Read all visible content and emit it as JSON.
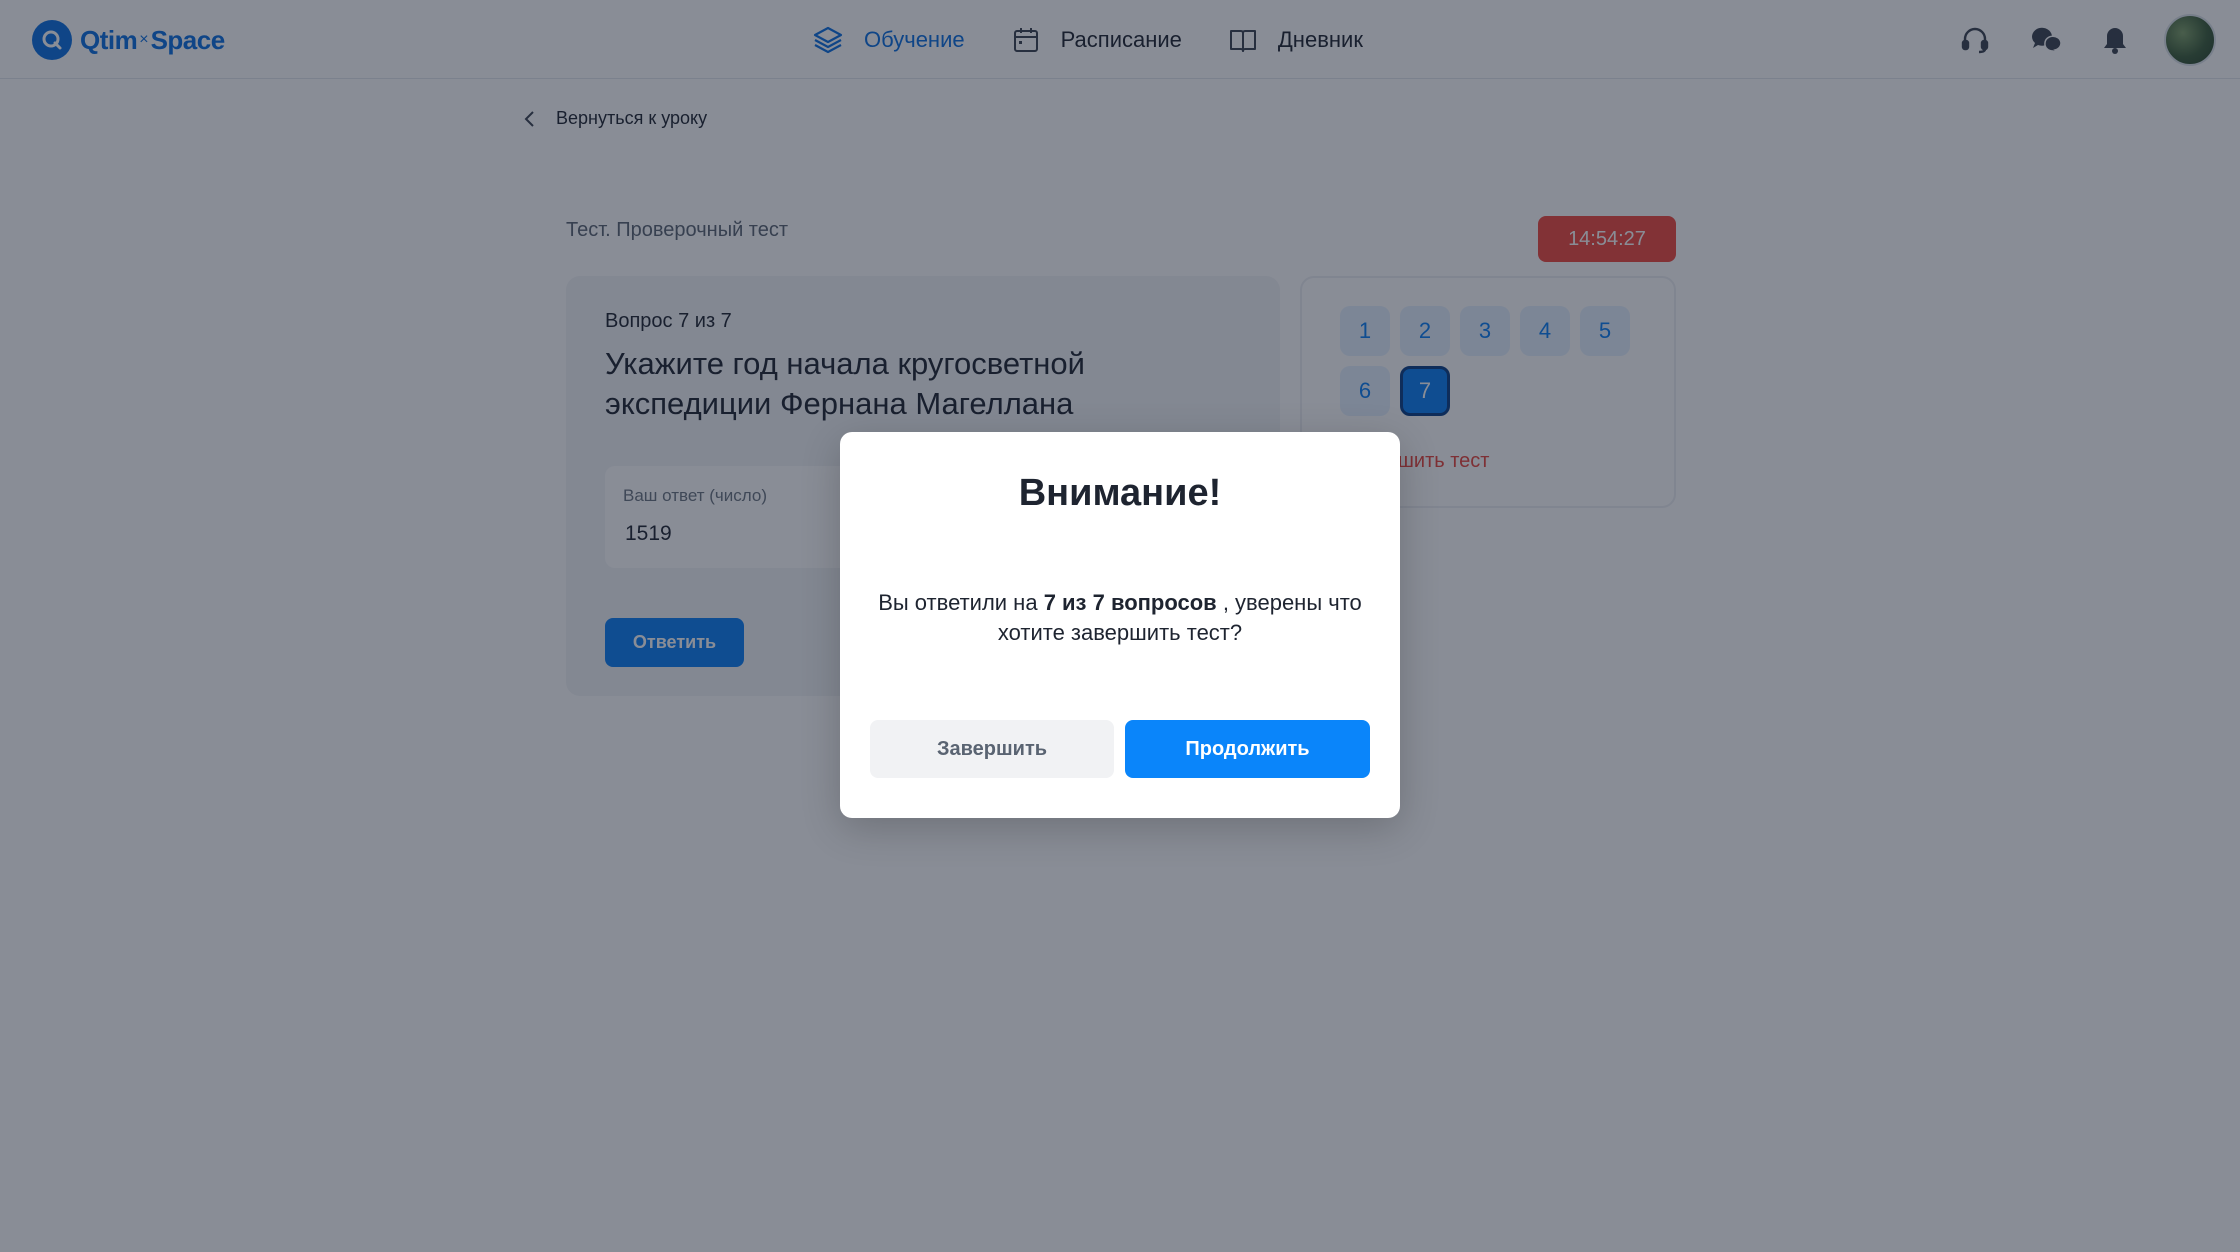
{
  "header": {
    "logo": {
      "left": "Qtim",
      "separator": "×",
      "right": "Space"
    },
    "nav": [
      {
        "label": "Обучение",
        "icon": "layers-icon",
        "active": true
      },
      {
        "label": "Расписание",
        "icon": "calendar-icon",
        "active": false
      },
      {
        "label": "Дневник",
        "icon": "book-icon",
        "active": false
      }
    ],
    "icons": [
      "headset-icon",
      "chat-icon",
      "bell-icon",
      "avatar"
    ]
  },
  "back_link": "Вернуться к уроку",
  "test": {
    "title": "Тест. Проверочный тест",
    "timer": "14:54:27",
    "question_counter": "Вопрос 7 из 7",
    "question_text": "Укажите год начала кругосветной экспедиции Фернана Магеллана",
    "answer_label": "Ваш ответ (число)",
    "answer_value": "1519",
    "answer_button": "Ответить",
    "question_numbers": [
      "1",
      "2",
      "3",
      "4",
      "5",
      "6",
      "7"
    ],
    "current_question": "7",
    "finish_link": "Завершить тест"
  },
  "modal": {
    "title": "Внимание!",
    "message_prefix": "Вы ответили на ",
    "message_bold": "7 из 7 вопросов",
    "message_suffix": " , уверены что хотите завершить тест?",
    "finish_button": "Завершить",
    "continue_button": "Продолжить"
  },
  "colors": {
    "accent": "#0a7ef5",
    "timer": "#f0483e",
    "danger_link": "#e8453c",
    "overlay": "rgba(20,27,45,0.5)"
  }
}
